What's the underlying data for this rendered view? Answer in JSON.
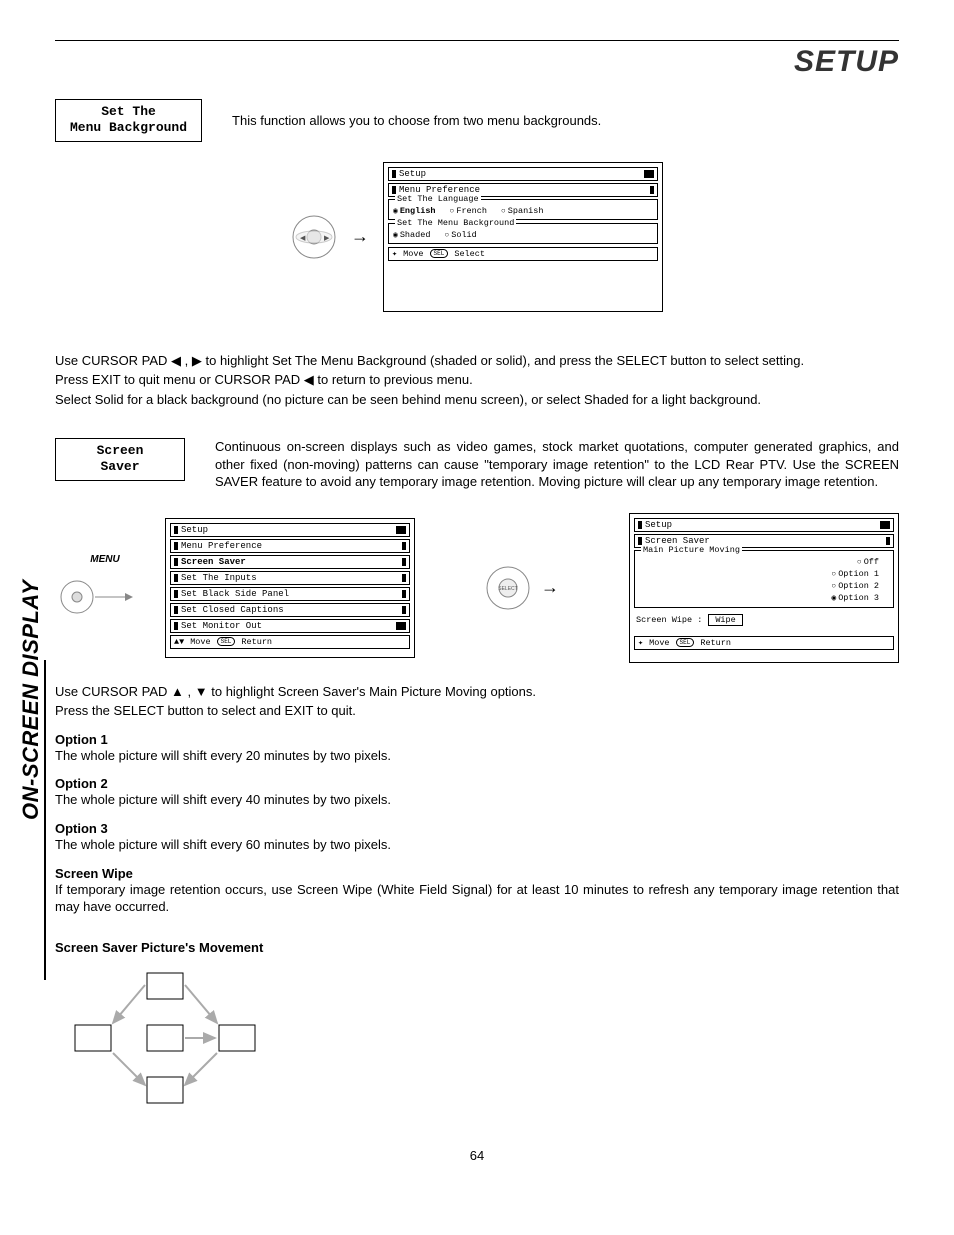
{
  "page": {
    "title": "SETUP",
    "sidebar": "ON-SCREEN DISPLAY",
    "number": "64"
  },
  "section1": {
    "box_line1": "Set The",
    "box_line2": "Menu Background",
    "intro": "This function allows you to choose from two menu backgrounds.",
    "osd": {
      "title": "Setup",
      "row2": "Menu Preference",
      "group1_legend": "Set The Language",
      "lang1": "English",
      "lang2": "French",
      "lang3": "Spanish",
      "group2_legend": "Set The Menu Background",
      "bg1": "Shaded",
      "bg2": "Solid",
      "footer_move": "Move",
      "footer_sel": "Select"
    },
    "para1": "Use CURSOR PAD ◀ , ▶ to highlight Set The Menu Background (shaded or solid), and press the SELECT button to select setting.",
    "para2": "Press EXIT to quit menu or CURSOR PAD ◀ to return to previous menu.",
    "para3": "Select Solid for a black background (no picture can be seen behind menu screen), or select Shaded for a light background."
  },
  "section2": {
    "box_line1": "Screen",
    "box_line2": "Saver",
    "intro": "Continuous on-screen displays such as video games, stock market quotations, computer generated graphics, and other fixed (non-moving) patterns can cause \"temporary image retention\" to the LCD Rear PTV.  Use the SCREEN SAVER feature to avoid any temporary image retention.  Moving picture will clear up any temporary image retention.",
    "menu_label": "MENU",
    "osd_left": {
      "title": "Setup",
      "items": [
        "Menu Preference",
        "Screen Saver",
        "Set The Inputs",
        "Set Black Side Panel",
        "Set Closed Captions",
        "Set Monitor Out"
      ],
      "footer_move": "Move",
      "footer_ret": "Return"
    },
    "osd_right": {
      "title": "Setup",
      "row2": "Screen Saver",
      "group_legend": "Main Picture Moving",
      "opts": [
        "Off",
        "Option 1",
        "Option 2",
        "Option 3"
      ],
      "wipe_label": "Screen Wipe :",
      "wipe_btn": "Wipe",
      "footer_move": "Move",
      "footer_ret": "Return"
    },
    "para1": "Use CURSOR PAD ▲ , ▼ to highlight Screen Saver's Main Picture Moving options.",
    "para2": "Press the SELECT button to select and EXIT to quit.",
    "opt1_h": "Option 1",
    "opt1_t": "The whole picture will shift every 20 minutes by two pixels.",
    "opt2_h": "Option 2",
    "opt2_t": "The whole picture will shift every 40 minutes by two pixels.",
    "opt3_h": "Option 3",
    "opt3_t": "The whole picture will shift every 60 minutes by two pixels.",
    "wipe_h": "Screen Wipe",
    "wipe_t": "If temporary image retention occurs, use Screen Wipe (White Field Signal) for at least 10 minutes to refresh any temporary image retention that may have occurred.",
    "move_h": "Screen Saver Picture's Movement"
  }
}
